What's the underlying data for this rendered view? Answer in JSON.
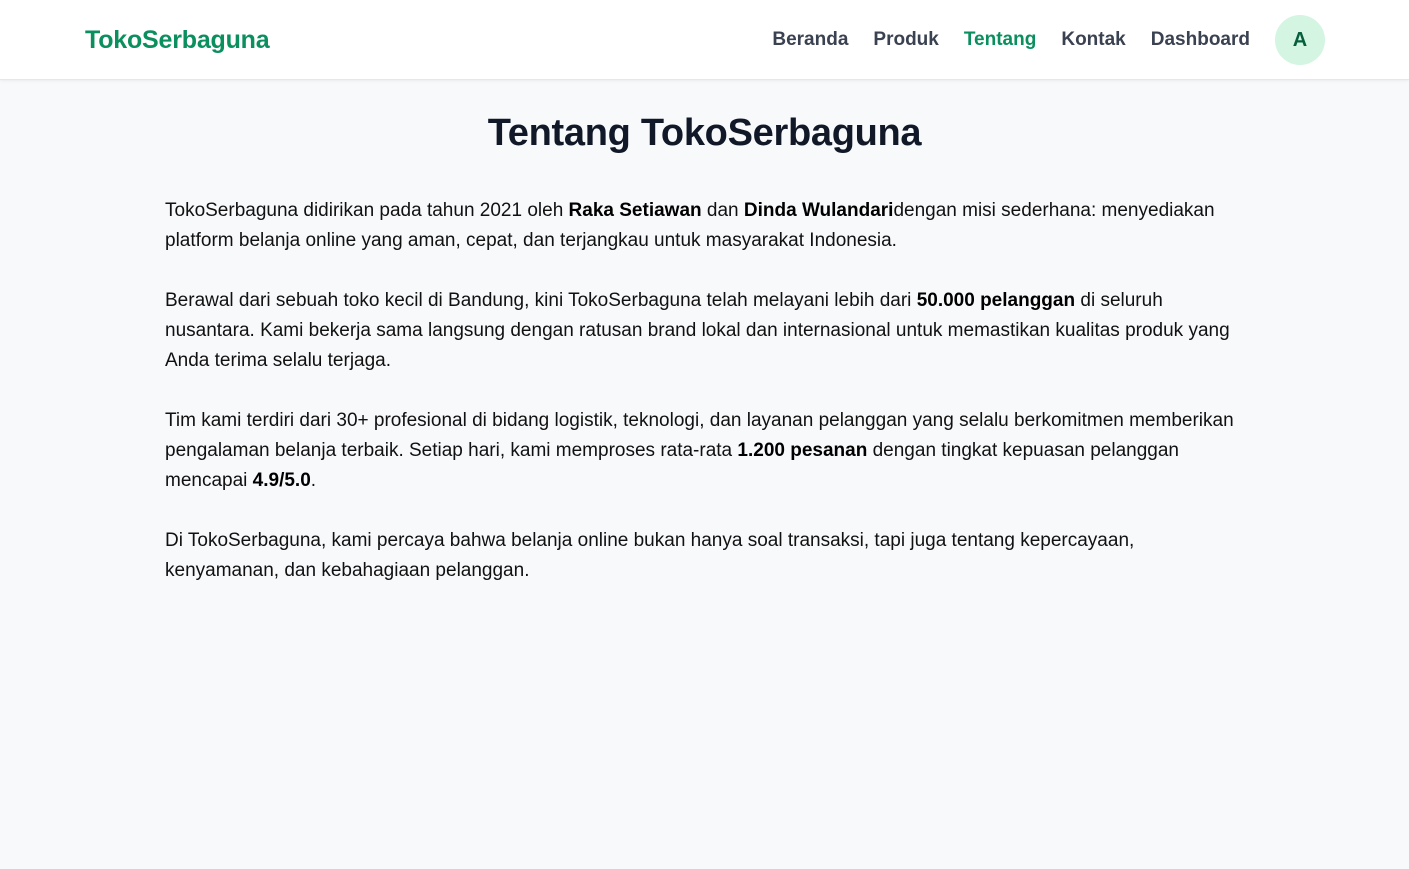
{
  "header": {
    "brand": "TokoSerbaguna",
    "nav": [
      {
        "label": "Beranda",
        "active": false
      },
      {
        "label": "Produk",
        "active": false
      },
      {
        "label": "Tentang",
        "active": true
      },
      {
        "label": "Kontak",
        "active": false
      },
      {
        "label": "Dashboard",
        "active": false
      }
    ],
    "avatar_initial": "A"
  },
  "main": {
    "title": "Tentang TokoSerbaguna",
    "paragraphs": [
      {
        "t1": "TokoSerbaguna didirikan pada tahun 2021 oleh ",
        "b1": "Raka Setiawan",
        "t2": " dan ",
        "b2": "Dinda Wulandari",
        "t3": "dengan misi sederhana: menyediakan platform belanja online yang aman, cepat, dan terjangkau untuk masyarakat Indonesia."
      },
      {
        "t1": "Berawal dari sebuah toko kecil di Bandung, kini TokoSerbaguna telah melayani lebih dari ",
        "b1": "50.000 pelanggan",
        "t2": " di seluruh nusantara. Kami bekerja sama langsung dengan ratusan brand lokal dan internasional untuk memastikan kualitas produk yang Anda terima selalu terjaga."
      },
      {
        "t1": "Tim kami terdiri dari 30+ profesional di bidang logistik, teknologi, dan layanan pelanggan yang selalu berkomitmen memberikan pengalaman belanja terbaik. Setiap hari, kami memproses rata-rata ",
        "b1": "1.200 pesanan",
        "t2": " dengan tingkat kepuasan pelanggan mencapai ",
        "b2": "4.9/5.0",
        "t3": "."
      },
      {
        "t1": "Di TokoSerbaguna, kami percaya bahwa belanja online bukan hanya soal transaksi, tapi juga tentang kepercayaan, kenyamanan, dan kebahagiaan pelanggan."
      }
    ]
  },
  "colors": {
    "accent": "#0b8f5e",
    "avatar_bg": "#d3f5e2",
    "page_bg": "#f8f9fb",
    "nav_text": "#3a4150"
  }
}
